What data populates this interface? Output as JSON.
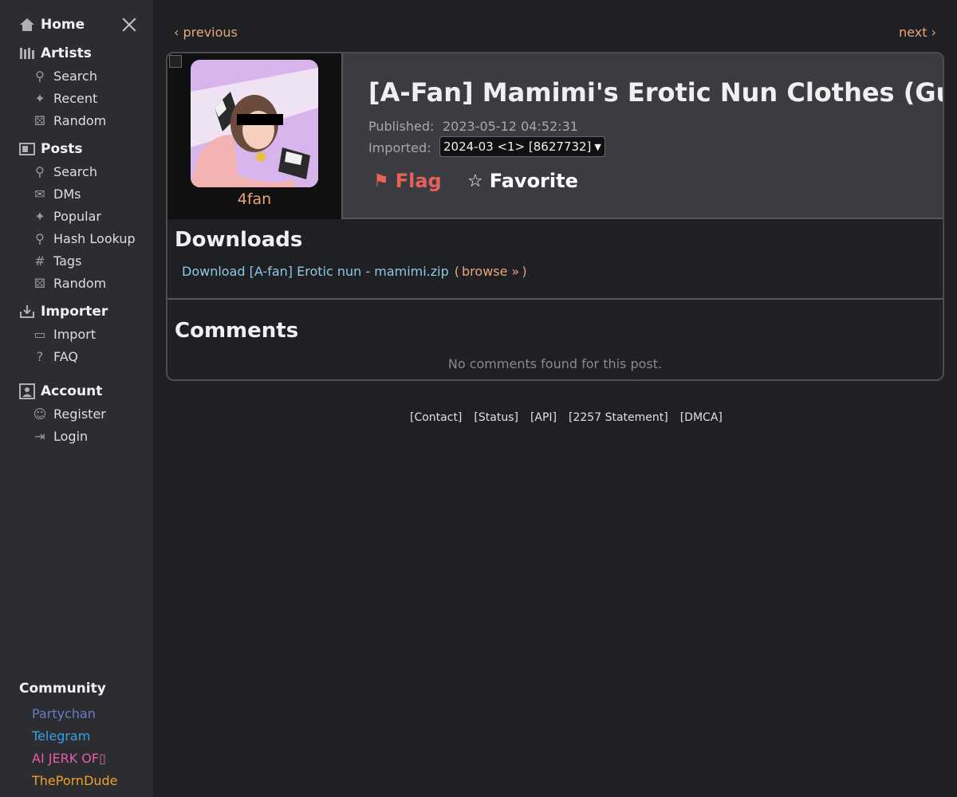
{
  "sidebar": {
    "home": "Home",
    "artists": {
      "label": "Artists",
      "items": [
        {
          "label": "Search",
          "icon": "search-icon"
        },
        {
          "label": "Recent",
          "icon": "sparkle-icon"
        },
        {
          "label": "Random",
          "icon": "dice-icon"
        }
      ]
    },
    "posts": {
      "label": "Posts",
      "items": [
        {
          "label": "Search",
          "icon": "search-icon"
        },
        {
          "label": "DMs",
          "icon": "mail-icon"
        },
        {
          "label": "Popular",
          "icon": "sparkle-icon"
        },
        {
          "label": "Hash Lookup",
          "icon": "search-icon"
        },
        {
          "label": "Tags",
          "icon": "hash-icon"
        },
        {
          "label": "Random",
          "icon": "dice-icon"
        }
      ]
    },
    "importer": {
      "label": "Importer",
      "items": [
        {
          "label": "Import",
          "icon": "monitor-icon"
        },
        {
          "label": "FAQ",
          "icon": "faq-icon"
        }
      ]
    },
    "account": {
      "label": "Account",
      "items": [
        {
          "label": "Register",
          "icon": "user-add-icon"
        },
        {
          "label": "Login",
          "icon": "login-icon"
        }
      ]
    },
    "community": {
      "label": "Community",
      "links": [
        {
          "label": "Partychan",
          "color": "#6b7bc4"
        },
        {
          "label": "Telegram",
          "color": "#3aa0e6"
        },
        {
          "label": "AI JERK OF▯",
          "color": "#e85aa8"
        },
        {
          "label": "ThePornDude",
          "color": "#f0a030"
        }
      ]
    }
  },
  "nav": {
    "previous": "‹ previous",
    "next": "next ›"
  },
  "post": {
    "artist_name": "4fan",
    "title": "[A-Fan] Mamimi's Erotic Nun Clothes (Gumroad)",
    "published_label": "Published:",
    "published_value": "2023-05-12 04:52:31",
    "imported_label": "Imported:",
    "imported_value": "2024-03 <1> [8627732]",
    "flag_label": "Flag",
    "favorite_label": "Favorite"
  },
  "downloads": {
    "title": "Downloads",
    "link_text": "Download [A-fan] Erotic nun - mamimi.zip",
    "open_paren": "(",
    "browse_text": "browse »",
    "close_paren": ")"
  },
  "comments": {
    "title": "Comments",
    "empty_text": "No comments found for this post."
  },
  "footer": [
    "[Contact]",
    "[Status]",
    "[API]",
    "[2257 Statement]",
    "[DMCA]"
  ],
  "colors": {
    "accent": "#e8a57a",
    "link": "#8fc7e6",
    "flag": "#e8605a"
  }
}
